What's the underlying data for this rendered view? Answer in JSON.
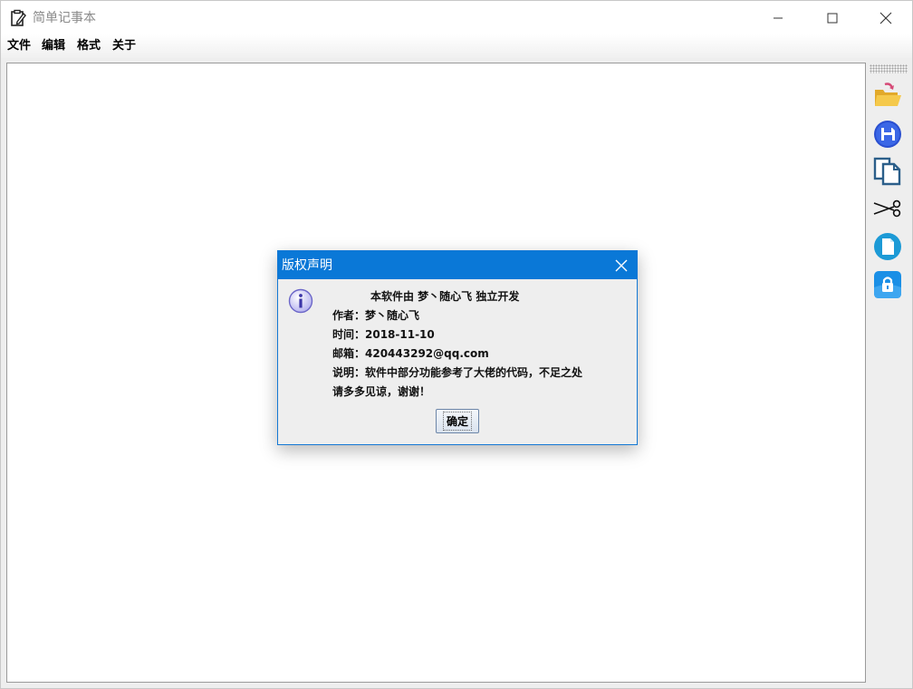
{
  "window": {
    "title": "简单记事本"
  },
  "menu": {
    "items": [
      {
        "label": "文件"
      },
      {
        "label": "编辑"
      },
      {
        "label": "格式"
      },
      {
        "label": "关于"
      }
    ]
  },
  "toolbar": {
    "tools": [
      {
        "icon": "open-folder-icon"
      },
      {
        "icon": "save-disk-icon"
      },
      {
        "icon": "copy-icon"
      },
      {
        "icon": "scissors-icon"
      },
      {
        "icon": "paste-document-icon"
      },
      {
        "icon": "lock-icon"
      }
    ]
  },
  "editor": {
    "content": ""
  },
  "dialog": {
    "title": "版权声明",
    "lines": [
      "本软件由 梦丶随心飞 独立开发",
      "作者：梦丶随心飞",
      "时间：2018-11-10",
      "邮箱：420443292@qq.com",
      "说明：软件中部分功能参考了大佬的代码，不足之处",
      "请多多见谅，谢谢！"
    ],
    "ok_label": "确定"
  },
  "colors": {
    "dialog_title_bg": "#0a78d7",
    "dialog_border": "#1478d4",
    "window_bg": "#eeeeee"
  }
}
